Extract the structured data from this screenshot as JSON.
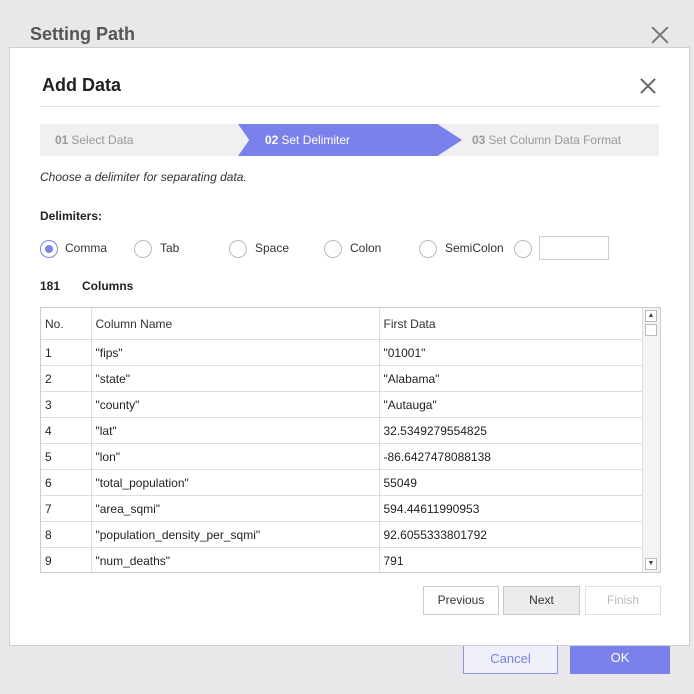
{
  "outer": {
    "title": "Setting Path",
    "cancel": "Cancel",
    "ok": "OK"
  },
  "dialog": {
    "title": "Add Data",
    "steps": [
      {
        "num": "01",
        "label": "Select Data"
      },
      {
        "num": "02",
        "label": "Set Delimiter"
      },
      {
        "num": "03",
        "label": "Set Column Data Format"
      }
    ],
    "instruction": "Choose a delimiter for separating data.",
    "delimiters_label": "Delimiters:",
    "delimiters": [
      "Comma",
      "Tab",
      "Space",
      "Colon",
      "SemiColon"
    ],
    "selected_delimiter": "Comma",
    "custom_delimiter": "",
    "column_count": "181",
    "columns_label": "Columns",
    "table": {
      "headers": [
        "No.",
        "Column Name",
        "First Data"
      ],
      "rows": [
        [
          "1",
          "\"fips\"",
          "\"01001\""
        ],
        [
          "2",
          "\"state\"",
          "\"Alabama\""
        ],
        [
          "3",
          "\"county\"",
          "\"Autauga\""
        ],
        [
          "4",
          "\"lat\"",
          "32.5349279554825"
        ],
        [
          "5",
          "\"lon\"",
          "-86.6427478088138"
        ],
        [
          "6",
          "\"total_population\"",
          "55049"
        ],
        [
          "7",
          "\"area_sqmi\"",
          "594.44611990953"
        ],
        [
          "8",
          "\"population_density_per_sqmi\"",
          "92.6055333801792"
        ],
        [
          "9",
          "\"num_deaths\"",
          "791"
        ]
      ]
    },
    "buttons": {
      "previous": "Previous",
      "next": "Next",
      "finish": "Finish"
    }
  },
  "colors": {
    "accent": "#7b81ea",
    "step_bg": "#f0f0f3"
  }
}
